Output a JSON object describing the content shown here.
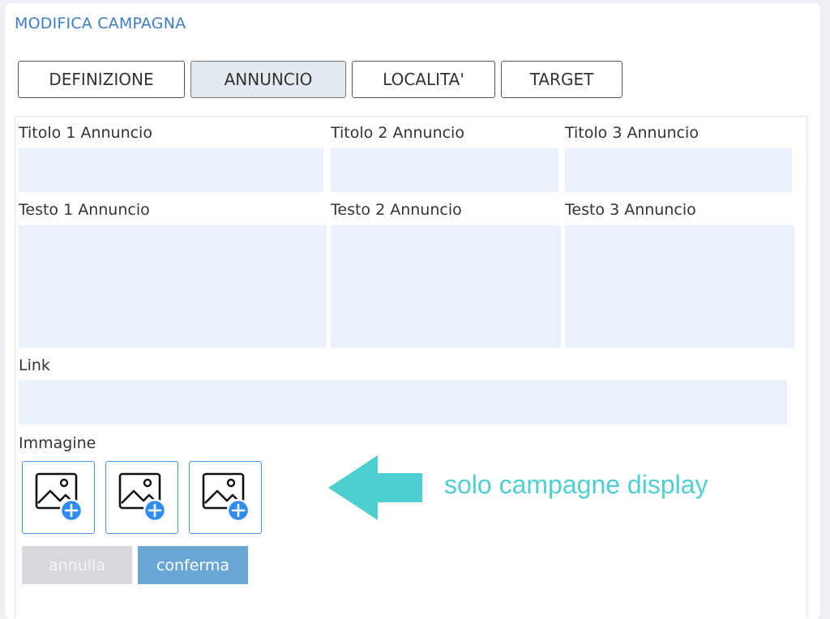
{
  "page": {
    "title": "MODIFICA CAMPAGNA"
  },
  "tabs": [
    {
      "label": "DEFINIZIONE",
      "active": false
    },
    {
      "label": "ANNUNCIO",
      "active": true
    },
    {
      "label": "LOCALITA'",
      "active": false
    },
    {
      "label": "TARGET",
      "active": false
    }
  ],
  "form": {
    "title1_label": "Titolo 1 Annuncio",
    "title2_label": "Titolo 2 Annuncio",
    "title3_label": "Titolo 3 Annuncio",
    "text1_label": "Testo 1 Annuncio",
    "text2_label": "Testo 2 Annuncio",
    "text3_label": "Testo 3 Annuncio",
    "link_label": "Link",
    "image_label": "Immagine",
    "title1_value": "",
    "title2_value": "",
    "title3_value": "",
    "text1_value": "",
    "text2_value": "",
    "text3_value": "",
    "link_value": ""
  },
  "image_slots": [
    {
      "icon": "add-image-icon"
    },
    {
      "icon": "add-image-icon"
    },
    {
      "icon": "add-image-icon"
    }
  ],
  "actions": {
    "cancel_label": "annulla",
    "confirm_label": "conferma"
  },
  "annotation": {
    "text": "solo campagne display",
    "icon": "arrow-left-icon"
  },
  "colors": {
    "accent": "#3b7fc4",
    "field_bg": "#eaf1fc",
    "confirm_bg": "#69a6d4",
    "cancel_bg": "#d7d9dd",
    "annotation": "#4ecfd0",
    "plus_badge": "#2f8cf0"
  }
}
